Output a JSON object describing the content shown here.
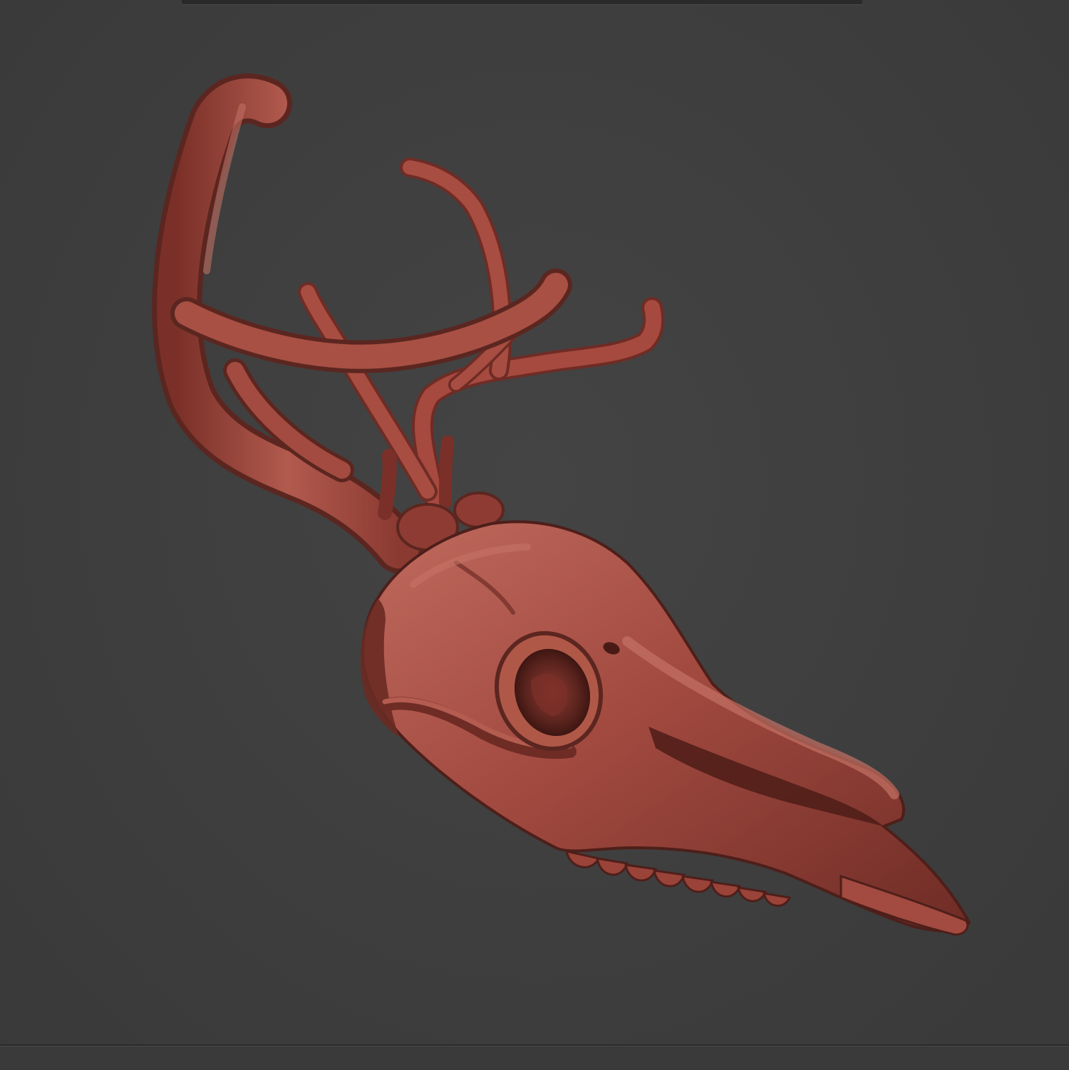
{
  "viewport": {
    "background_color": "#3e3e3e",
    "model": {
      "subject-icon": "deer-skull-with-antlers-icon",
      "material_color": "#a24a40",
      "shadow_color": "#5c2620",
      "highlight_color": "#c97366"
    }
  }
}
